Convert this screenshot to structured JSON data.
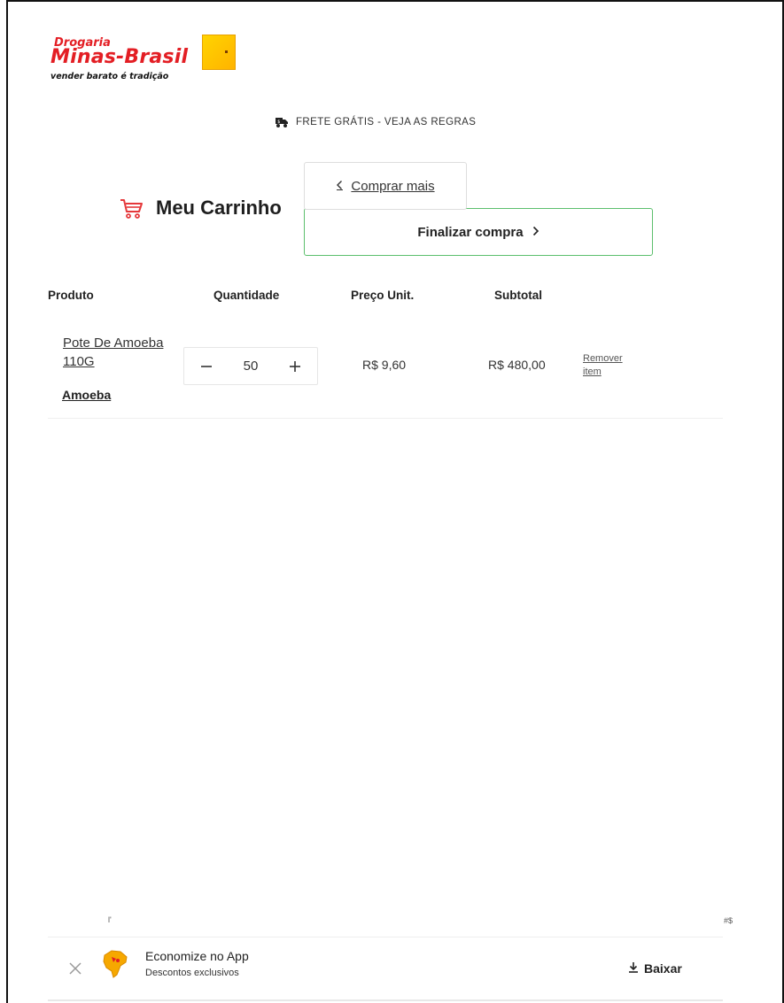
{
  "logo": {
    "top_text": "Drogaria",
    "brand": "Minas-Brasil",
    "tagline": "vender barato é tradição"
  },
  "shipping": {
    "label": "FRETE GRÁTIS - VEJA AS REGRAS"
  },
  "cart": {
    "title": "Meu Carrinho"
  },
  "actions": {
    "more_label": "Comprar mais",
    "finish_label": "Finalizar compra"
  },
  "table": {
    "headers": [
      "Produto",
      "Quantidade",
      "Preço Unit.",
      "Subtotal"
    ],
    "items": [
      {
        "name": "Pote De Amoeba 110G",
        "brand": "Amoeba",
        "quantity": "50",
        "unit_price": "R$ 9,60",
        "subtotal": "R$ 480,00",
        "remove_label": "Remover item"
      }
    ]
  },
  "marks": {
    "left": "l'",
    "right": "#$"
  },
  "app_banner": {
    "title": "Economize no App",
    "subtitle": "Descontos exclusivos",
    "download_label": "Baixar"
  },
  "colors": {
    "brand_red": "#e31e24",
    "accent_green": "#5cbf6d",
    "logo_yellow": "#ffd400"
  }
}
